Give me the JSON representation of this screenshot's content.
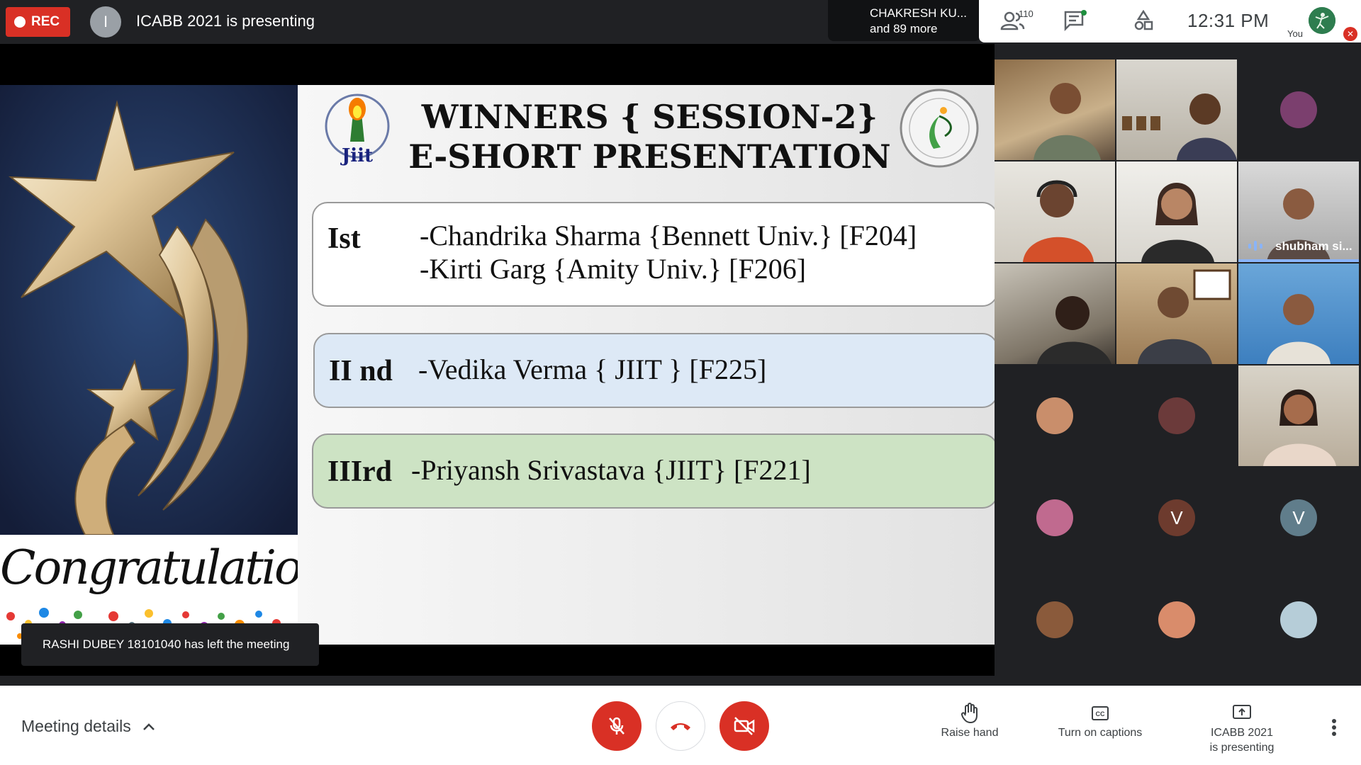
{
  "topbar": {
    "rec_label": "REC",
    "presenter_initial": "I",
    "presenter_text": "ICABB 2021 is presenting",
    "speaker_line1": "CHAKRESH KU...",
    "speaker_line2": "and 89 more",
    "people_count": "110",
    "clock": "12:31  PM",
    "you_label": "You"
  },
  "slide": {
    "title_line1": "WINNERS { SESSION-2}",
    "title_line2": "E-SHORT PRESENTATION",
    "logo_text": "Jiit",
    "congratulations": "Congratulations",
    "winners": [
      {
        "rank": "Ist",
        "names": [
          "-Chandrika Sharma {Bennett Univ.} [F204]",
          "-Kirti Garg {Amity Univ.} [F206]"
        ]
      },
      {
        "rank": "II nd",
        "names": [
          "-Vedika Verma { JIIT } [F225]"
        ]
      },
      {
        "rank": "IIIrd",
        "names": [
          "-Priyansh Srivastava {JIIT} [F221]"
        ]
      }
    ],
    "colors": {
      "first_bg": "#ffffff",
      "second_bg": "#dde9f6",
      "third_bg": "#cde3c4"
    }
  },
  "toast": {
    "text": "RASHI DUBEY 18101040 has left the meeting"
  },
  "participants": {
    "speaking_name": "shubham si...",
    "initials": {
      "v1": "V",
      "v2": "V"
    }
  },
  "bottombar": {
    "meeting_details": "Meeting details",
    "raise_hand": "Raise hand",
    "captions": "Turn on captions",
    "present_line1": "ICABB 2021",
    "present_line2": "is presenting",
    "accent_red": "#d93025"
  }
}
